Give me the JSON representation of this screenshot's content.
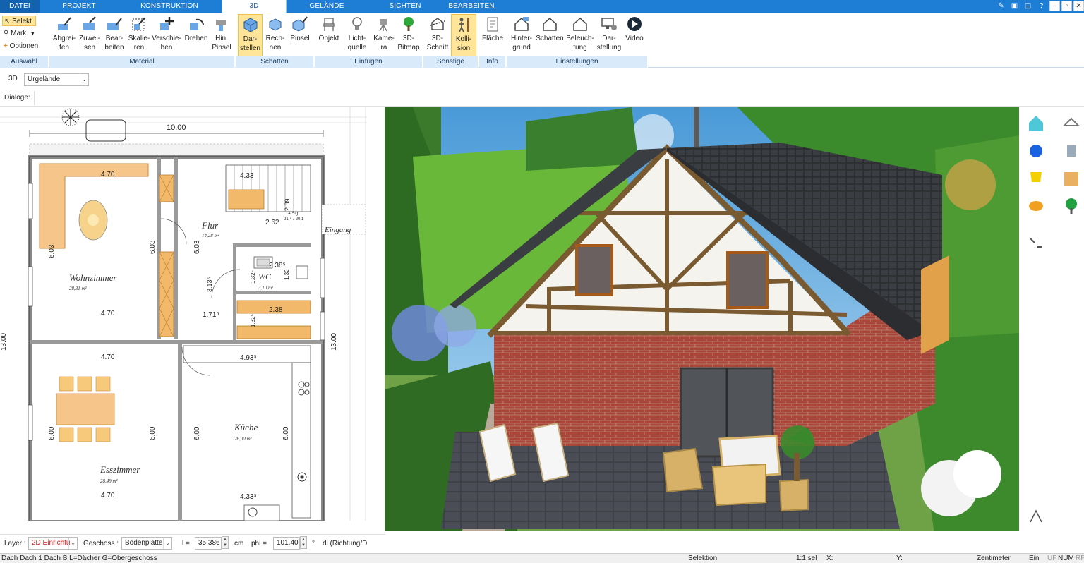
{
  "menu": {
    "tabs": [
      "DATEI",
      "PROJEKT",
      "KONSTRUKTION",
      "3D",
      "GELÄNDE",
      "SICHTEN",
      "BEARBEITEN"
    ],
    "active": "3D"
  },
  "ribbon": {
    "auswahl": {
      "selekt": "Selekt",
      "mark": "Mark.",
      "optionen": "Optionen",
      "group": "Auswahl"
    },
    "material": {
      "buttons": [
        "Abgrei-\nfen",
        "Zuwei-\nsen",
        "Bear-\nbeiten",
        "Skalie-\nren",
        "Verschie-\nben",
        "Drehen",
        "Hin.\nPinsel"
      ],
      "group": "Material"
    },
    "schatten": {
      "buttons": [
        "Dar-\nstellen",
        "Rech-\nnen",
        "Pinsel"
      ],
      "group": "Schatten"
    },
    "einfuegen": {
      "buttons": [
        "Objekt",
        "Licht-\nquelle",
        "Kame-\nra",
        "3D-\nBitmap"
      ],
      "group": "Einfügen"
    },
    "sonstige": {
      "buttons": [
        "3D-\nSchnitt",
        "Kolli-\nsion"
      ],
      "group": "Sonstige"
    },
    "info": {
      "buttons": [
        "Fläche"
      ],
      "group": "Info"
    },
    "einstellungen": {
      "buttons": [
        "Hinter-\ngrund",
        "Schatten",
        "Beleuch-\ntung",
        "Dar-\nstellung",
        "Video"
      ],
      "group": "Einstellungen"
    }
  },
  "view": {
    "mode": "3D",
    "terrain": "Urgelände"
  },
  "dialog_label": "Dialoge:",
  "plan": {
    "dims": {
      "top": "10.00",
      "left": "13.00",
      "right": "13.00",
      "w1": "4.70",
      "w2": "4.70",
      "w3": "4.70",
      "w4": "4.70",
      "h1": "6.03",
      "h2": "6.03",
      "h3": "6.03",
      "e1": "6.00",
      "e2": "6.00",
      "e3": "6.00",
      "e4": "6.00",
      "f1": "2.62",
      "f2": "4.33",
      "f3": "4.33⁵",
      "f4": "4.93⁵",
      "f5": "1.71⁵",
      "f6": "3.13⁵",
      "f7": "2.38⁵",
      "f8": "2.38",
      "f9": "1.32⁵",
      "f10": "1.32⁵",
      "f11": "2.89",
      "f12": "1.32"
    },
    "rooms": {
      "wohn": "Wohnzimmer",
      "wohn_area": "28,31 m²",
      "flur": "Flur",
      "flur_area": "14,28 m²",
      "wc": "WC",
      "wc_area": "3,10 m²",
      "kueche": "Küche",
      "kueche_area": "26,00 m²",
      "ess": "Esszimmer",
      "ess_area": "28,49 m²",
      "stair": "14 Stg",
      "stair_dim": "21,4 / 20,1",
      "entry": "Eingang"
    }
  },
  "layerbar": {
    "layer_label": "Layer :",
    "layer_value": "2D Einrichtu",
    "geschoss_label": "Geschoss :",
    "geschoss_value": "Bodenplatte",
    "l_label": "l =",
    "l_value": "35,386",
    "l_unit": "cm",
    "phi_label": "phi =",
    "phi_value": "101,40",
    "phi_unit": "°",
    "dl_label": "dl (Richtung/D"
  },
  "status": {
    "text": "Dach Dach 1 Dach B L=Dächer G=Obergeschoss",
    "selektion": "Selektion",
    "scale": "1:1 sel",
    "x": "X:",
    "y": "Y:",
    "unit": "Zentimeter",
    "ein": "Ein",
    "uf": "UF",
    "num": "NUM",
    "rf": "RF"
  },
  "colors": {
    "accent": "#1e7ed6",
    "active": "#ffe59a",
    "group": "#d9ebfb",
    "brick": "#a8463a"
  }
}
